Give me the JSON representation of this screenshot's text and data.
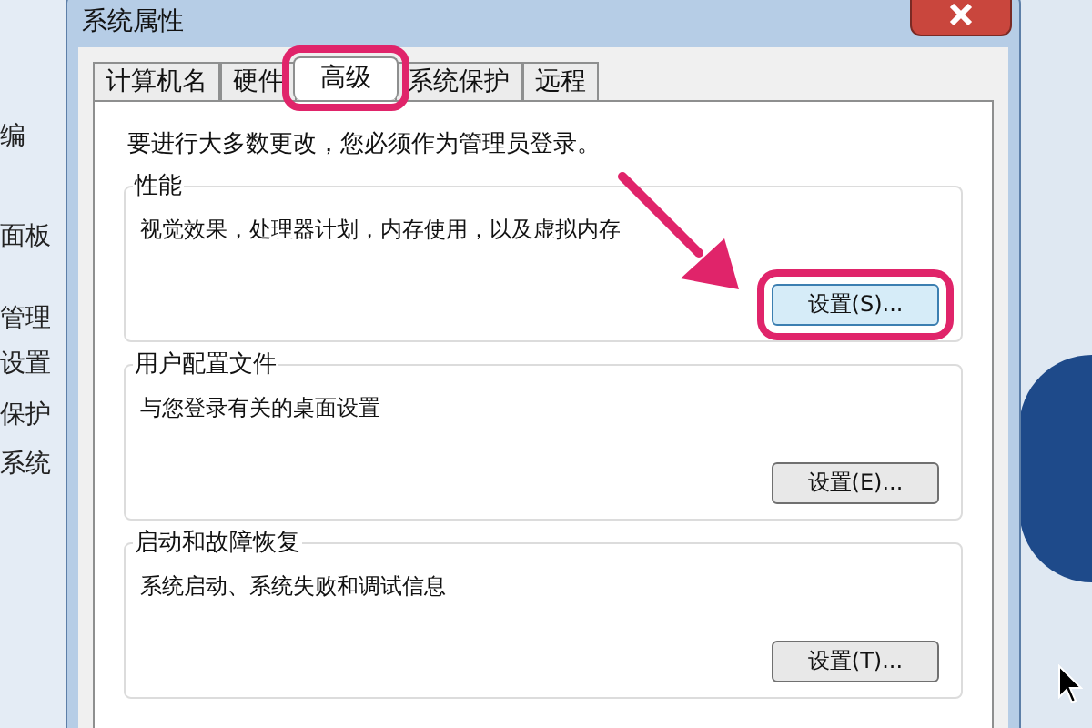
{
  "background_window": {
    "fragments": [
      "编",
      "面板",
      "管理",
      "设置",
      "保护",
      "系统"
    ]
  },
  "window": {
    "title": "系统属性"
  },
  "tabs": [
    {
      "label": "计算机名",
      "selected": false,
      "highlighted": false
    },
    {
      "label": "硬件",
      "selected": false,
      "highlighted": false
    },
    {
      "label": "高级",
      "selected": true,
      "highlighted": true
    },
    {
      "label": "系统保护",
      "selected": false,
      "highlighted": false
    },
    {
      "label": "远程",
      "selected": false,
      "highlighted": false
    }
  ],
  "notice": "要进行大多数更改，您必须作为管理员登录。",
  "groups": [
    {
      "title": "性能",
      "description": "视觉效果，处理器计划，内存使用，以及虚拟内存",
      "button": "设置(S)...",
      "highlighted": true
    },
    {
      "title": "用户配置文件",
      "description": "与您登录有关的桌面设置",
      "button": "设置(E)...",
      "highlighted": false
    },
    {
      "title": "启动和故障恢复",
      "description": "系统启动、系统失败和调试信息",
      "button": "设置(T)...",
      "highlighted": false
    }
  ]
}
